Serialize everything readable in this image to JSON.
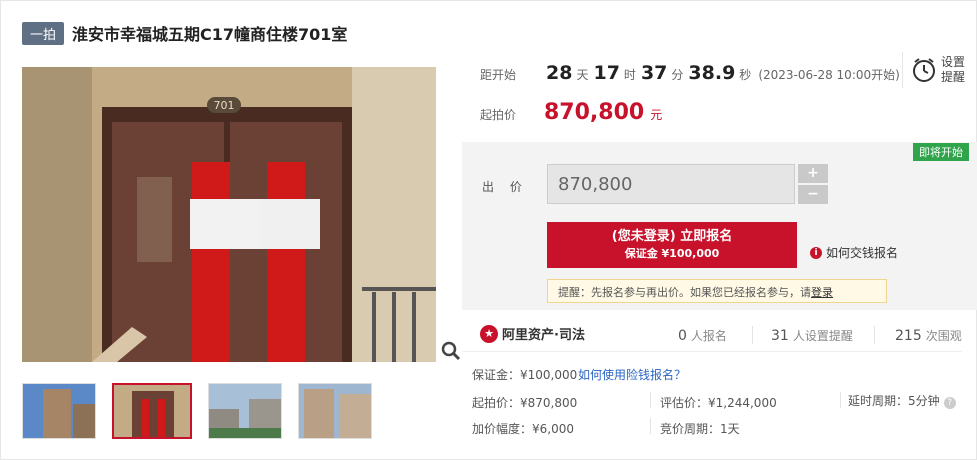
{
  "header": {
    "tag": "一拍",
    "title": "淮安市幸福城五期C17幢商住楼701室"
  },
  "countdown": {
    "label": "距开始",
    "days": "28",
    "days_unit": "天",
    "hours": "17",
    "hours_unit": "时",
    "minutes": "37",
    "minutes_unit": "分",
    "seconds": "38.9",
    "seconds_unit": "秒",
    "start_time": "(2023-06-28 10:00开始)"
  },
  "reminder_button": {
    "label": "设置提醒",
    "icon": "clock-icon"
  },
  "start_price": {
    "label": "起拍价",
    "value": "870,800",
    "unit": "元"
  },
  "bid": {
    "status_badge": "即将开始",
    "label": "出 价",
    "value": "870,800",
    "plus": "+",
    "minus": "−",
    "signup_line1": "(您未登录) 立即报名",
    "signup_line2": "保证金 ¥100,000",
    "how_to_pay": "如何交钱报名",
    "notice_prefix": "提醒：先报名参与再出价。如果您已经报名参与，请",
    "notice_link": "登录"
  },
  "platform": {
    "name": "阿里资产·司法",
    "signups": "0",
    "signups_unit": "人报名",
    "reminders": "31",
    "reminders_unit": "人设置提醒",
    "views": "215",
    "views_unit": "次围观"
  },
  "details": {
    "deposit": "保证金：¥100,000",
    "deposit_link": "如何使用险钱报名？",
    "start_price": "起拍价：¥870,800",
    "appraisal": "评估价：¥1,244,000",
    "delay": "延时周期：5分钟",
    "increment": "加价幅度：¥6,000",
    "period": "竞价周期：1天"
  },
  "main_image": {
    "door_number": "701"
  },
  "colors": {
    "accent": "#c8112b",
    "badge_green": "#2fa44a",
    "tag_bg": "#5f6f84"
  }
}
